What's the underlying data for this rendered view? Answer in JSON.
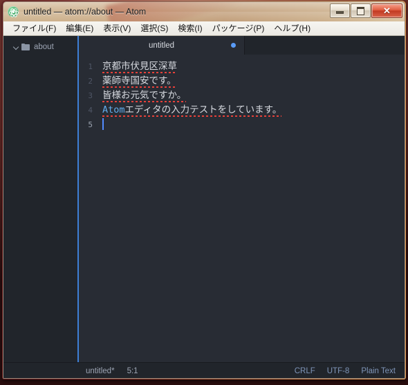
{
  "window": {
    "title": "untitled — atom://about — Atom",
    "app_icon": "atom-icon",
    "controls": {
      "minimize": "minimize-icon",
      "maximize": "maximize-icon",
      "close": "✕"
    }
  },
  "menubar": {
    "items": [
      {
        "label": "ファイル(F)"
      },
      {
        "label": "編集(E)"
      },
      {
        "label": "表示(V)"
      },
      {
        "label": "選択(S)"
      },
      {
        "label": "検索(I)"
      },
      {
        "label": "パッケージ(P)"
      },
      {
        "label": "ヘルプ(H)"
      }
    ]
  },
  "tree_view": {
    "items": [
      {
        "label": "about",
        "expanded": true,
        "icon": "folder-icon",
        "chevron": "chevron-down-icon"
      }
    ]
  },
  "tabs": [
    {
      "label": "untitled",
      "modified": true,
      "active": true
    }
  ],
  "editor": {
    "lines": [
      {
        "number": "1",
        "text": "京都市伏見区深草",
        "spellcheck": true
      },
      {
        "number": "2",
        "text": "薬師寺国安です。",
        "spellcheck": true
      },
      {
        "number": "3",
        "text": "皆様お元気ですか。",
        "spellcheck": true
      },
      {
        "number": "4",
        "text": "Atomエディタの入力テストをしています。",
        "spellcheck": true,
        "keyword": "Atom",
        "rest": "エディタの入力テストをしています。"
      },
      {
        "number": "5",
        "text": "",
        "spellcheck": false
      }
    ],
    "cursor_line": 5,
    "colors": {
      "background": "#282c34",
      "gutter_text": "#4f5666",
      "text": "#d7dae0",
      "keyword": "#61aeee",
      "cursor": "#528bff",
      "spellcheck_underline": "#e8413a"
    }
  },
  "status_bar": {
    "file_name": "untitled*",
    "cursor_position": "5:1",
    "line_ending": "CRLF",
    "encoding": "UTF-8",
    "grammar": "Plain Text"
  }
}
